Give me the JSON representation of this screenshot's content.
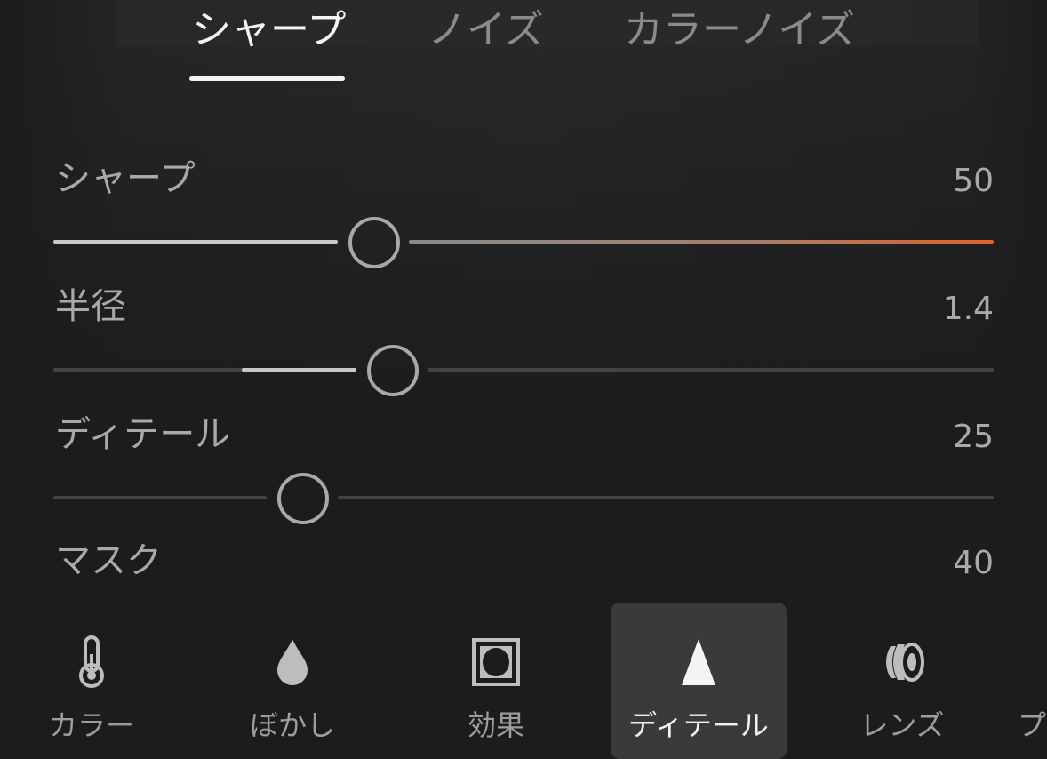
{
  "tabs": [
    {
      "label": "シャープ",
      "active": true
    },
    {
      "label": "ノイズ",
      "active": false
    },
    {
      "label": "カラーノイズ",
      "active": false
    }
  ],
  "sliders": [
    {
      "label": "シャープ",
      "value": "50",
      "level": 0.34,
      "track_accent": "#e0622a"
    },
    {
      "label": "半径",
      "value": "1.4",
      "level": 0.36
    },
    {
      "label": "ディテール",
      "value": "25",
      "level": 0.265
    },
    {
      "label": "マスク",
      "value": "40"
    }
  ],
  "bottom_nav": [
    {
      "label": "カラー",
      "icon": "thermometer-icon"
    },
    {
      "label": "ぼかし",
      "icon": "droplet-icon"
    },
    {
      "label": "効果",
      "icon": "vignette-frame-icon"
    },
    {
      "label": "ディテール",
      "icon": "triangle-detail-icon",
      "active": true
    },
    {
      "label": "レンズ",
      "icon": "lens-icon"
    },
    {
      "label": "プ"
    }
  ],
  "colors": {
    "background": "#1c1c1d",
    "active_tab": "#f4f4f4",
    "accent_orange": "#e0622a",
    "nav_active_bg": "#3a3a3b"
  }
}
